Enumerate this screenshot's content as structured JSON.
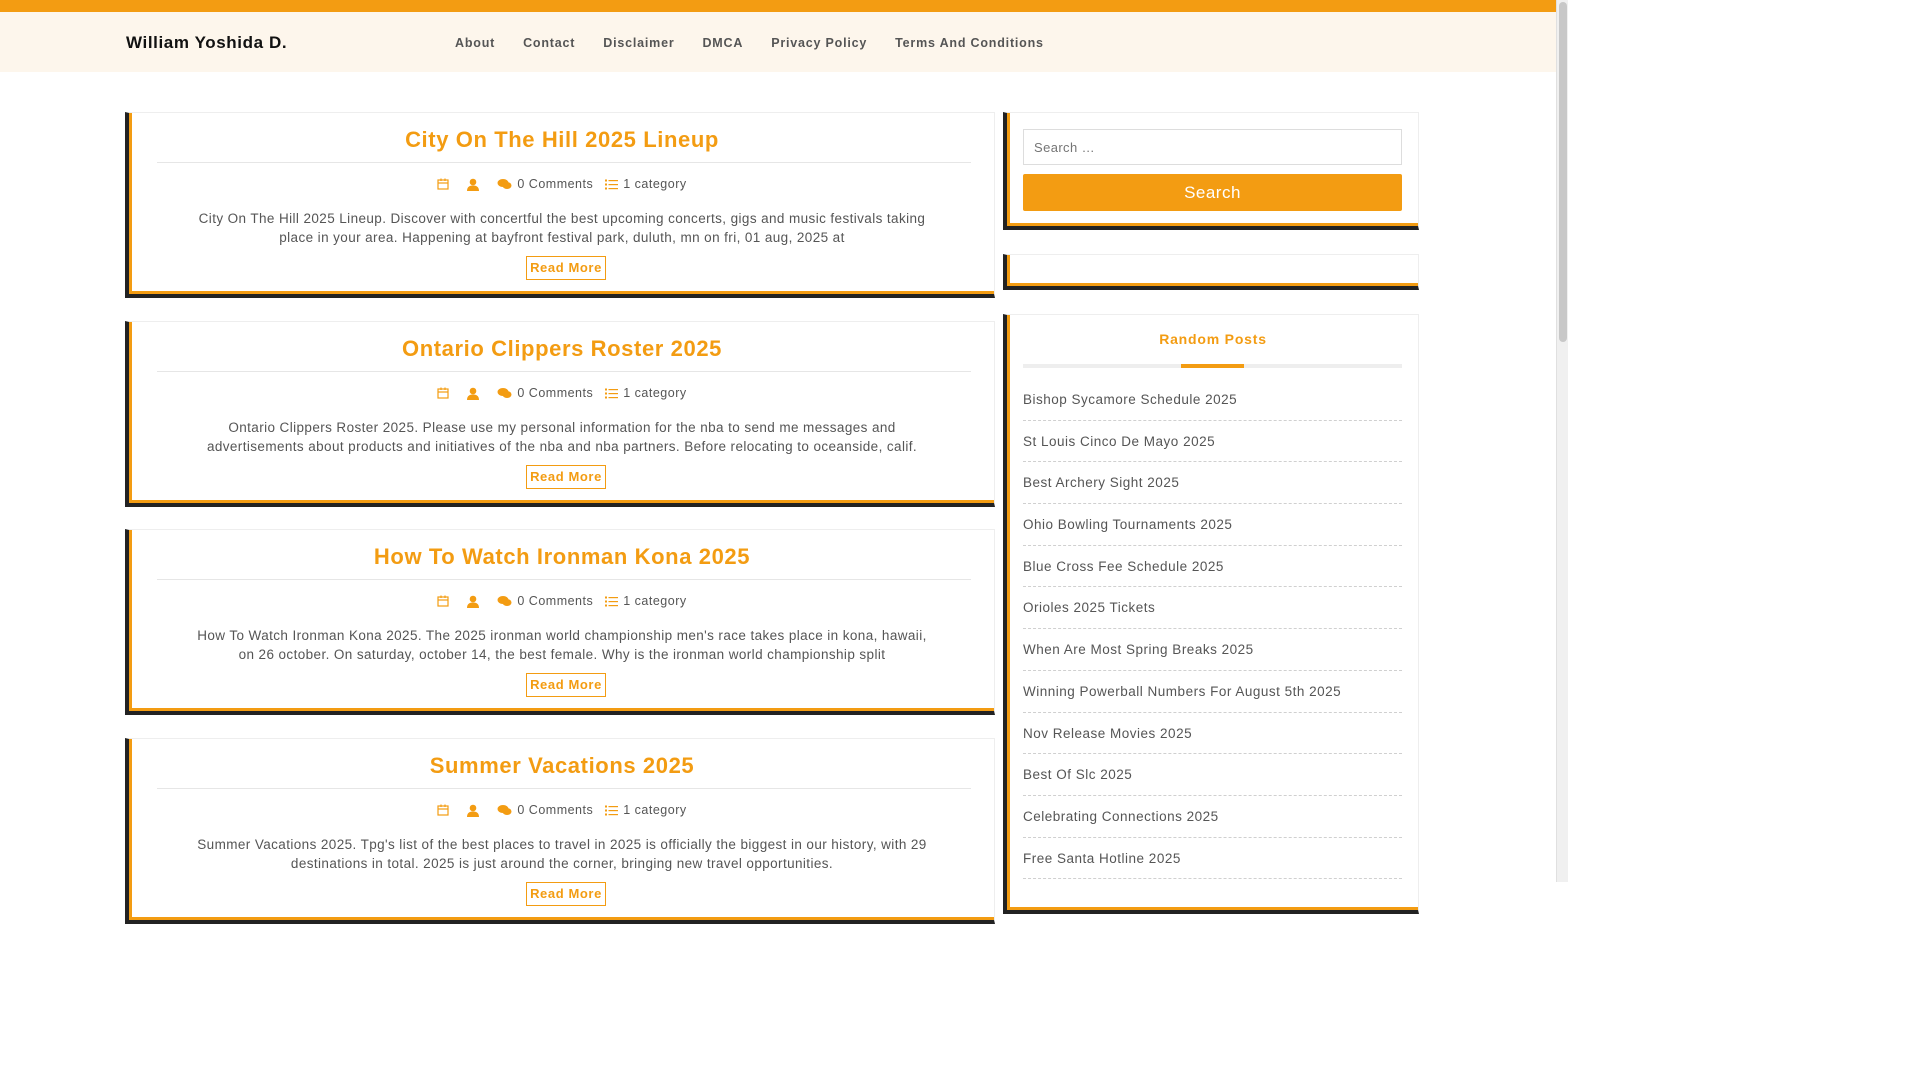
{
  "site": {
    "title": "William Yoshida D."
  },
  "nav": [
    "About",
    "Contact",
    "Disclaimer",
    "DMCA",
    "Privacy Policy",
    "Terms And Conditions"
  ],
  "colors": {
    "accent": "#f39c12",
    "header_bg": "#fdf6ec",
    "text": "#555555",
    "title": "#111111"
  },
  "posts": [
    {
      "title": "City On The Hill 2025 Lineup",
      "comments": "0 Comments",
      "category": "1 category",
      "excerpt": "City On The Hill 2025 Lineup. Discover with concertful the best upcoming concerts, gigs and music festivals taking place in your area. Happening at bayfront festival park, duluth, mn on fri, 01 aug, 2025 at",
      "read_more": "Read More"
    },
    {
      "title": "Ontario Clippers Roster 2025",
      "comments": "0 Comments",
      "category": "1 category",
      "excerpt": "Ontario Clippers Roster 2025. Please use my personal information for the nba to send me messages and advertisements about products and initiatives of the nba and nba partners. Before relocating to oceanside, calif. Player birthdate,",
      "read_more": "Read More"
    },
    {
      "title": "How To Watch Ironman Kona 2025",
      "comments": "0 Comments",
      "category": "1 category",
      "excerpt": "How To Watch Ironman Kona 2025. The 2025 ironman world championship men's race takes place in kona, hawaii, on 26 october. On saturday, october 14, the best female. Why is the ironman world championship split",
      "read_more": "Read More"
    },
    {
      "title": "Summer Vacations 2025",
      "comments": "0 Comments",
      "category": "1 category",
      "excerpt": "Summer Vacations 2025. Tpg's list of the best places to travel in 2025 is officially the biggest in our history, with 29 destinations in total. 2025 is just around the corner, bringing new travel opportunities.",
      "read_more": "Read More"
    }
  ],
  "search": {
    "placeholder": "Search …",
    "button": "Search"
  },
  "random_posts": {
    "title": "Random Posts",
    "items": [
      "Bishop Sycamore Schedule 2025",
      "St Louis Cinco De Mayo 2025",
      "Best Archery Sight 2025",
      "Ohio Bowling Tournaments 2025",
      "Blue Cross Fee Schedule 2025",
      "Orioles 2025 Tickets",
      "When Are Most Spring Breaks 2025",
      "Winning Powerball Numbers For August 5th 2025",
      "Nov Release Movies 2025",
      "Best Of Slc 2025",
      "Celebrating Connections 2025",
      "Free Santa Hotline 2025"
    ]
  }
}
